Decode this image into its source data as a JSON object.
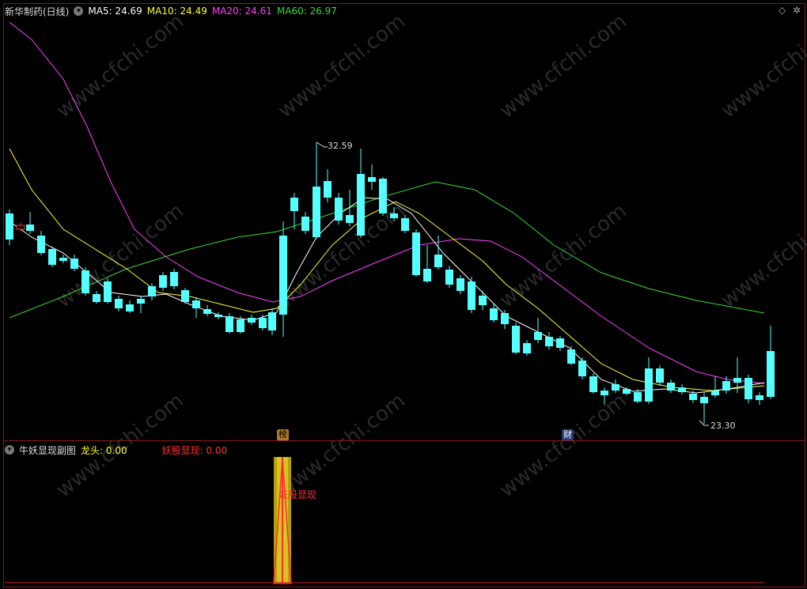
{
  "top_legend": {
    "title": "新华制药(日线)",
    "ma5": "MA5: 24.69",
    "ma10": "MA10: 24.49",
    "ma20": "MA20: 24.61",
    "ma60": "MA60: 26.97"
  },
  "colors": {
    "ma5": "#ffffff",
    "ma10": "#ffff33",
    "ma20": "#ff40ff",
    "ma60": "#33dd33",
    "up": "#ff3b3b",
    "down": "#54ffff",
    "frame": "#8b1a1a"
  },
  "price_labels": {
    "high": "32.59",
    "low": "23.30"
  },
  "badges": {
    "bang": "榜",
    "cai": "财"
  },
  "sub_legend": {
    "title": "牛妖显现副图",
    "longtou": "龙头: 0.00",
    "yaogu": "妖股显现: 0.00",
    "signal_label": "妖股显现"
  },
  "watermark": "www.cfchi.com",
  "icons": {
    "expand": "diamond-icon",
    "settings": "gear-icon",
    "collapse": "chevron-down-icon"
  }
}
